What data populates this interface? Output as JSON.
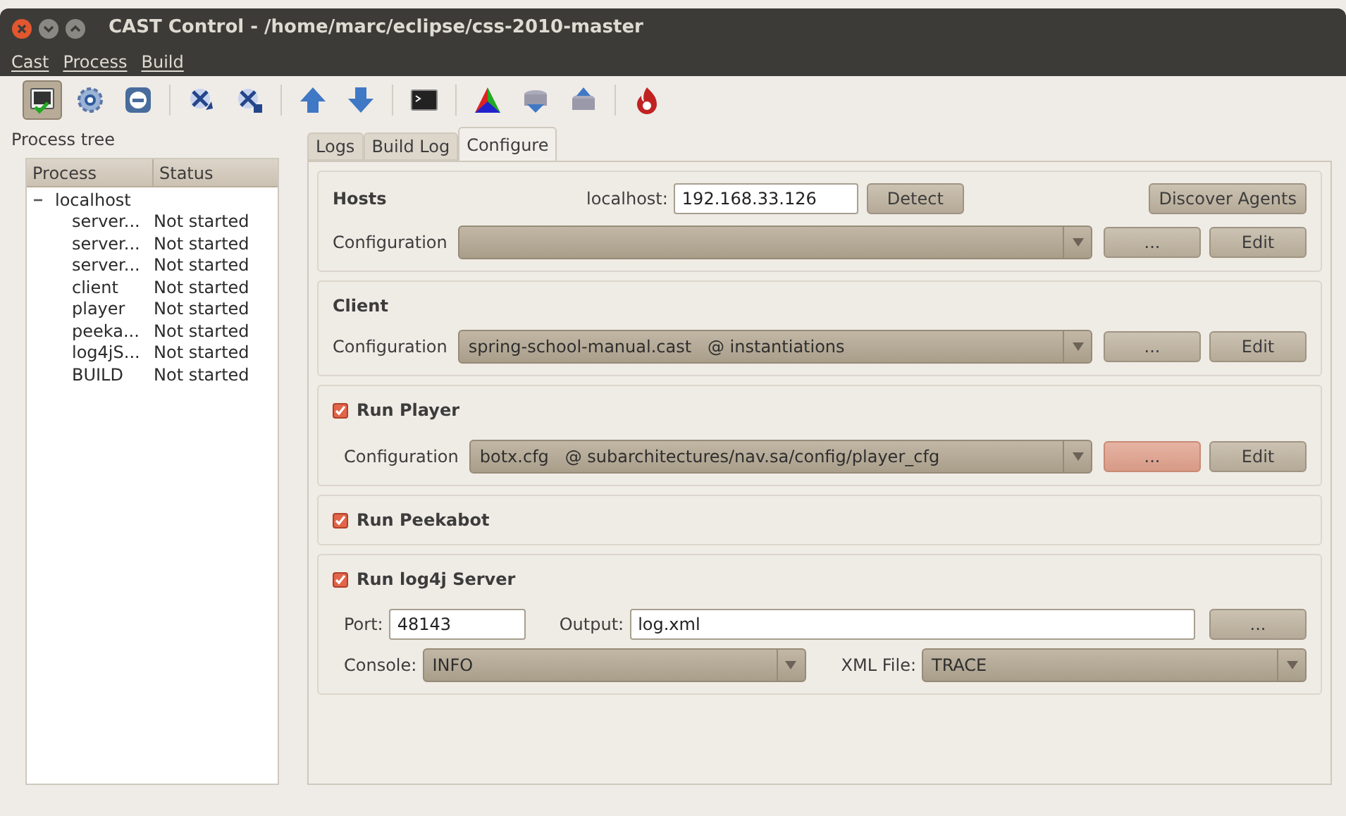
{
  "window": {
    "title": "CAST Control - /home/marc/eclipse/css-2010-master"
  },
  "menu": [
    "Cast",
    "Process",
    "Build"
  ],
  "toolbar": [
    [
      {
        "kind": "terminal-check",
        "pressed": true
      },
      {
        "kind": "gear",
        "pressed": false
      },
      {
        "kind": "stop",
        "pressed": false
      }
    ],
    [
      {
        "kind": "cross-arrow",
        "pressed": false
      },
      {
        "kind": "cross-square",
        "pressed": false
      }
    ],
    [
      {
        "kind": "up",
        "pressed": false
      },
      {
        "kind": "down",
        "pressed": false
      }
    ],
    [
      {
        "kind": "console",
        "pressed": false
      }
    ],
    [
      {
        "kind": "triangle",
        "pressed": false
      },
      {
        "kind": "db-down",
        "pressed": false
      },
      {
        "kind": "db-up",
        "pressed": false
      }
    ],
    [
      {
        "kind": "flame",
        "pressed": false
      }
    ]
  ],
  "process_tree": {
    "label": "Process tree",
    "columns": [
      "Process",
      "Status"
    ],
    "items": [
      {
        "name": "localhost",
        "expanded": true,
        "children": [
          {
            "name": "server...",
            "status": "Not started"
          },
          {
            "name": "server...",
            "status": "Not started"
          },
          {
            "name": "server...",
            "status": "Not started"
          },
          {
            "name": "client",
            "status": "Not started"
          },
          {
            "name": "player",
            "status": "Not started"
          },
          {
            "name": "peeka...",
            "status": "Not started"
          },
          {
            "name": "log4jS...",
            "status": "Not started"
          },
          {
            "name": "BUILD",
            "status": "Not started"
          }
        ]
      }
    ]
  },
  "tabs": [
    {
      "label": "Logs",
      "selected": false
    },
    {
      "label": "Build Log",
      "selected": false
    },
    {
      "label": "Configure",
      "selected": true
    }
  ],
  "hosts": {
    "title": "Hosts",
    "host_label": "localhost:",
    "host_value": "192.168.33.126",
    "detect": "Detect",
    "discover": "Discover Agents",
    "config_label": "Configuration",
    "browse": {
      "label": "...",
      "hover": false
    },
    "edit": "Edit"
  },
  "client": {
    "title": "Client",
    "config_label": "Configuration",
    "config_value": "spring-school-manual.cast   @ instantiations",
    "browse": {
      "label": "...",
      "hover": false
    },
    "edit": "Edit"
  },
  "player": {
    "title": "Run Player",
    "checked": true,
    "config_label": "Configuration",
    "config_value": "botx.cfg   @ subarchitectures/nav.sa/config/player_cfg",
    "browse": {
      "label": "...",
      "hover": true
    },
    "edit": "Edit"
  },
  "peekabot": {
    "title": "Run Peekabot",
    "checked": true
  },
  "log4j": {
    "title": "Run log4j Server",
    "checked": true,
    "port_label": "Port:",
    "port_value": "48143",
    "output_label": "Output:",
    "output_value": "log.xml",
    "browse": {
      "label": "...",
      "hover": false
    },
    "console_label": "Console:",
    "console_value": "INFO",
    "xml_label": "XML File:",
    "xml_value": "TRACE"
  }
}
